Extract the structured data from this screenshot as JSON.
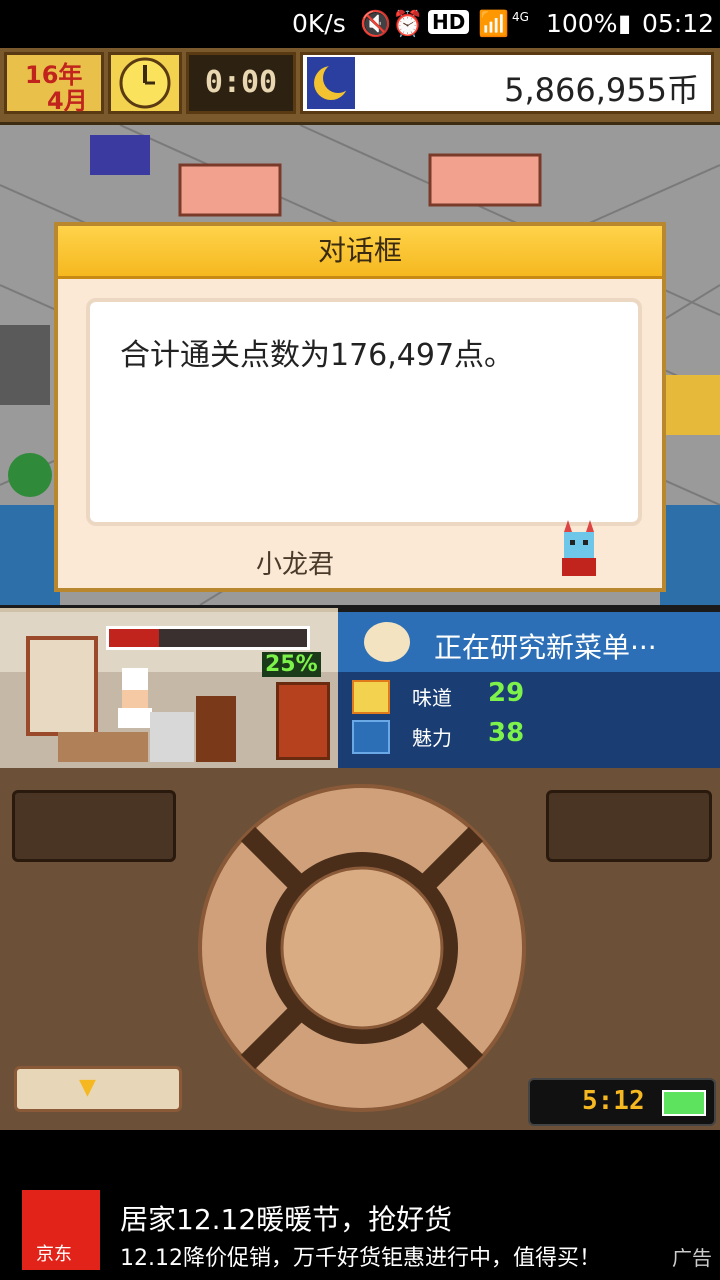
{
  "status_bar": {
    "speed": "0K/s",
    "hd": "HD",
    "network": "4G",
    "battery": "100%",
    "time": "05:12"
  },
  "hud": {
    "date_year": "16年",
    "date_month": "4月",
    "timer": "0:00",
    "money": "5,866,955币"
  },
  "dialog": {
    "title": "对话框",
    "message": "合计通关点数为176,497点。",
    "speaker": "小龙君"
  },
  "kitchen": {
    "progress_percent": 25,
    "progress_label": "25%"
  },
  "research": {
    "title": "正在研究新菜单···",
    "stats": [
      {
        "label": "味道",
        "value": "29"
      },
      {
        "label": "魅力",
        "value": "38"
      }
    ]
  },
  "controls": {
    "clock": "5:12"
  },
  "ad": {
    "brand": "京东",
    "title": "居家12.12暖暖节，抢好货",
    "subtitle": "12.12降价促销，万千好货钜惠进行中，值得买！",
    "ad_label": "广告"
  },
  "colors": {
    "accent_gold": "#f5b820",
    "dialog_bg": "#fbe9d5",
    "research_blue": "#1a3d73",
    "progress_red": "#c0241d",
    "stat_green": "#7cf24a"
  }
}
